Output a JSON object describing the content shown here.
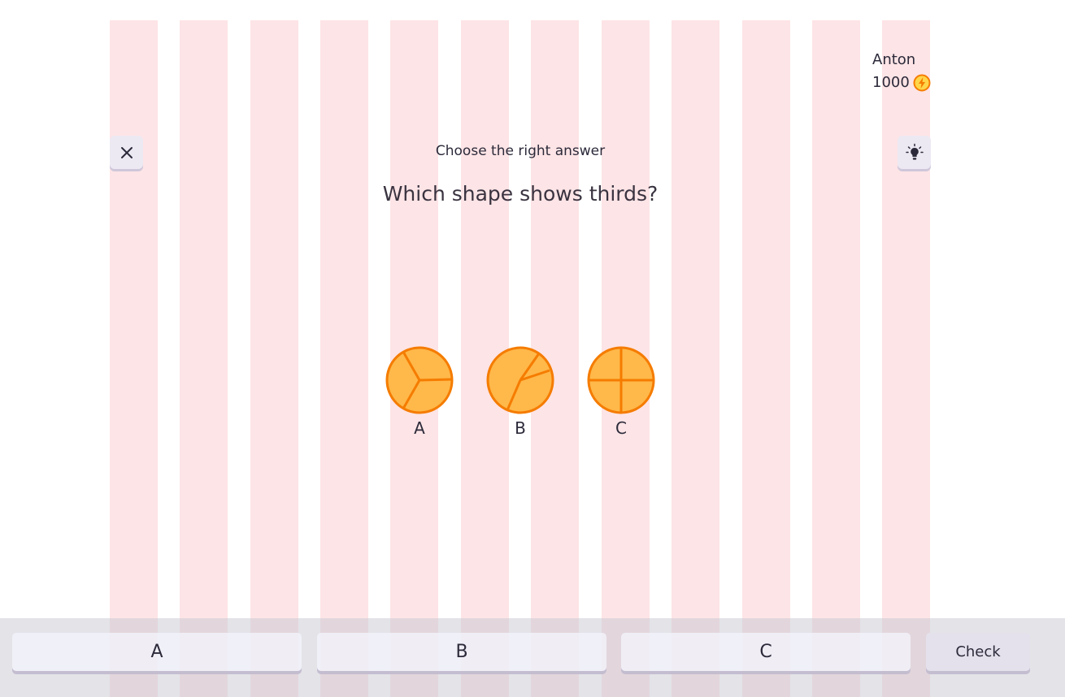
{
  "user": {
    "name": "Anton",
    "coins": "1000",
    "coin_icon": "lightning-coin-icon"
  },
  "toolbar": {
    "close_icon": "close-icon",
    "hint_icon": "lightbulb-icon"
  },
  "quiz": {
    "instruction": "Choose the right answer",
    "question": "Which shape shows thirds?",
    "shapes": [
      {
        "label": "A",
        "description_icon": "circle-split-in-three-equal-parts"
      },
      {
        "label": "B",
        "description_icon": "circle-split-in-three-unequal-parts"
      },
      {
        "label": "C",
        "description_icon": "circle-split-in-four-equal-parts"
      }
    ]
  },
  "answers": [
    {
      "label": "A"
    },
    {
      "label": "B"
    },
    {
      "label": "C"
    }
  ],
  "check_label": "Check",
  "colors": {
    "grid_column": "#fde4e6",
    "fraction_fill": "#ffb84a",
    "fraction_stroke": "#f57c00",
    "button_bg": "#ede9f3"
  }
}
